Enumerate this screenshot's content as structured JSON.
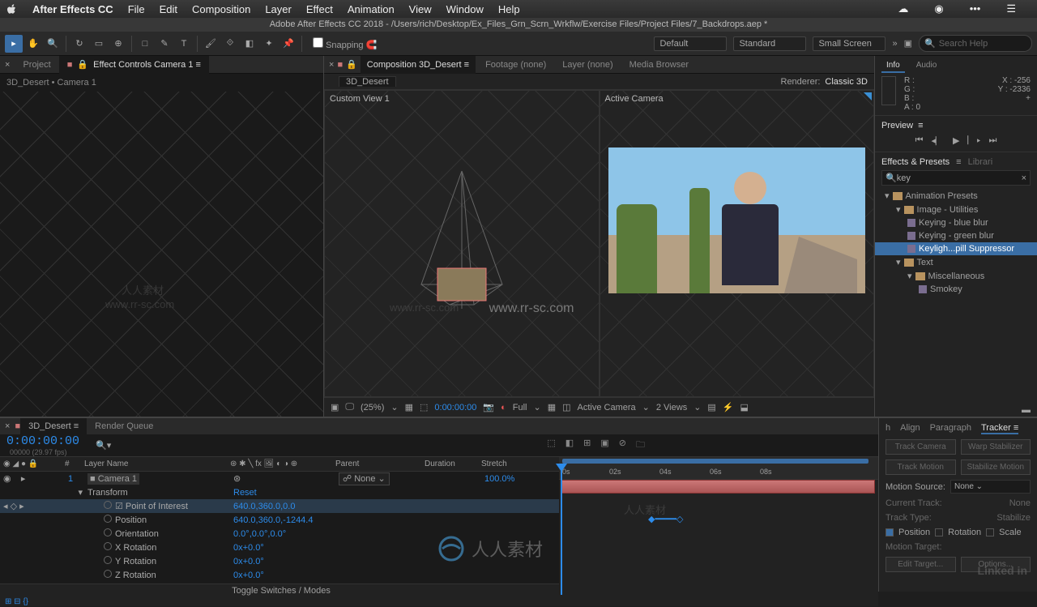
{
  "menubar": {
    "app": "After Effects CC",
    "items": [
      "File",
      "Edit",
      "Composition",
      "Layer",
      "Effect",
      "Animation",
      "View",
      "Window",
      "Help"
    ]
  },
  "window_title": "Adobe After Effects CC 2018 - /Users/rich/Desktop/Ex_Files_Grn_Scrn_Wrkflw/Exercise Files/Project Files/7_Backdrops.aep *",
  "toolbar": {
    "snapping": "Snapping",
    "workspace1": "Default",
    "workspace2": "Standard",
    "workspace3": "Small Screen",
    "search_placeholder": "Search Help"
  },
  "left": {
    "tab_project": "Project",
    "tab_effect_controls": "Effect Controls Camera 1",
    "breadcrumb": "3D_Desert • Camera 1"
  },
  "center": {
    "tab_comp": "Composition 3D_Desert",
    "tab_footage": "Footage (none)",
    "tab_layer": "Layer (none)",
    "tab_media": "Media Browser",
    "subtab": "3D_Desert",
    "renderer_label": "Renderer:",
    "renderer_value": "Classic 3D",
    "view_left": "Custom View 1",
    "view_right": "Active Camera",
    "zoom": "(25%)",
    "time": "0:00:00:00",
    "res": "Full",
    "camera": "Active Camera",
    "views": "2 Views"
  },
  "info": {
    "tab_info": "Info",
    "tab_audio": "Audio",
    "r": "R :",
    "g": "G :",
    "b": "B :",
    "a": "A :  0",
    "x": "X : -256",
    "y": "Y : -2336",
    "plus": "+"
  },
  "preview": {
    "title": "Preview"
  },
  "effects_presets": {
    "title": "Effects & Presets",
    "tab2": "Librari",
    "search": "key",
    "tree": [
      {
        "l": 0,
        "t": "folder",
        "label": "Animation Presets",
        "open": true
      },
      {
        "l": 1,
        "t": "folder",
        "label": "Image - Utilities",
        "open": true
      },
      {
        "l": 2,
        "t": "preset",
        "label": "Keying - blue blur"
      },
      {
        "l": 2,
        "t": "preset",
        "label": "Keying - green blur"
      },
      {
        "l": 2,
        "t": "preset",
        "label": "Keyligh...pill Suppressor",
        "sel": true
      },
      {
        "l": 1,
        "t": "folder",
        "label": "Text",
        "open": true
      },
      {
        "l": 2,
        "t": "folder",
        "label": "Miscellaneous",
        "open": true
      },
      {
        "l": 3,
        "t": "preset",
        "label": "Smokey"
      }
    ]
  },
  "timeline": {
    "tab_comp": "3D_Desert",
    "tab_render": "Render Queue",
    "timecode": "0:00:00:00",
    "fps": "00000 (29.97 fps)",
    "col_num": "#",
    "col_layer": "Layer Name",
    "col_parent": "Parent",
    "col_duration": "Duration",
    "col_stretch": "Stretch",
    "layer1": {
      "num": "1",
      "name": "Camera 1",
      "parent": "None",
      "stretch": "100.0%"
    },
    "transform": "Transform",
    "reset": "Reset",
    "props": [
      {
        "name": "Point of Interest",
        "val": "640.0,360.0,0.0",
        "sel": true
      },
      {
        "name": "Position",
        "val": "640.0,360.0,-1244.4"
      },
      {
        "name": "Orientation",
        "val": "0.0°,0.0°,0.0°"
      },
      {
        "name": "X Rotation",
        "val": "0x+0.0°"
      },
      {
        "name": "Y Rotation",
        "val": "0x+0.0°"
      },
      {
        "name": "Z Rotation",
        "val": "0x+0.0°"
      }
    ],
    "toggle": "Toggle Switches / Modes",
    "ruler": [
      "0s",
      "02s",
      "04s",
      "06s",
      "08s"
    ]
  },
  "tracker": {
    "tabs": [
      "h",
      "Align",
      "Paragraph",
      "Tracker"
    ],
    "track_camera": "Track Camera",
    "warp": "Warp Stabilizer",
    "track_motion": "Track Motion",
    "stabilize": "Stabilize Motion",
    "motion_source": "Motion Source:",
    "source_val": "None",
    "current_track": "Current Track:",
    "ct_val": "None",
    "track_type": "Track Type:",
    "tt_val": "Stabilize",
    "pos": "Position",
    "rot": "Rotation",
    "scale": "Scale",
    "motion_target": "Motion Target:",
    "edit_target": "Edit Target...",
    "options": "Options..."
  },
  "branding": {
    "linkedin": "Linked in",
    "rrsc": "人人素材",
    "wm": "www.rr-sc.com"
  }
}
